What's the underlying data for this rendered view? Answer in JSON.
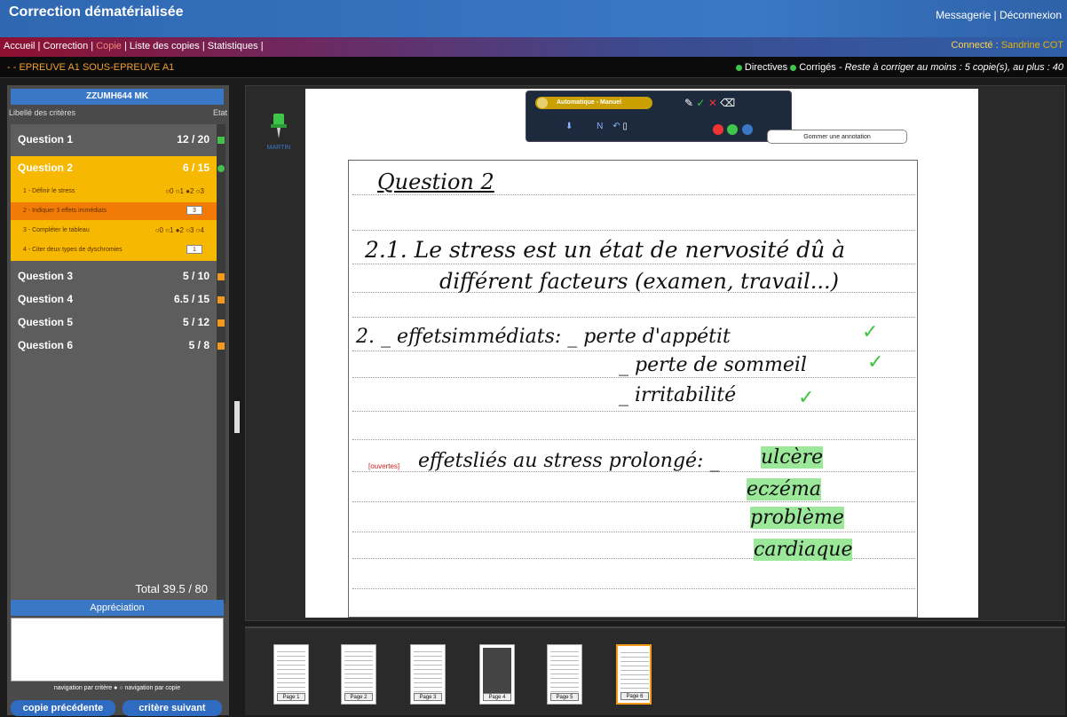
{
  "header": {
    "title": "Correction dématérialisée",
    "links": "Messagerie | Déconnexion"
  },
  "nav": {
    "items": [
      "Accueil",
      "Correction",
      "Copie",
      "Liste des copies",
      "Statistiques"
    ],
    "active": "Copie",
    "connected_label": "Connecté :",
    "connected_user": "Sandrine COT"
  },
  "exam": {
    "title": "- - EPREUVE A1 SOUS-EPREUVE A1",
    "directives": "Directives",
    "corriges": "Corrigés",
    "remaining": "- Reste à corriger au moins :  5 copie(s), au plus : 40"
  },
  "student": {
    "code": "ZZUMH644 MK"
  },
  "criteria_header": {
    "left": "Libellé des critères",
    "right": "Etat"
  },
  "questions": [
    {
      "name": "Question 1",
      "score": "12 / 20",
      "status": "green"
    },
    {
      "name": "Question 2",
      "score": "6 / 15",
      "status": "green"
    },
    {
      "name": "Question 3",
      "score": "5 / 10",
      "status": "orange"
    },
    {
      "name": "Question 4",
      "score": "6.5 / 15",
      "status": "orange"
    },
    {
      "name": "Question 5",
      "score": "5 / 12",
      "status": "orange"
    },
    {
      "name": "Question 6",
      "score": "5 / 8",
      "status": "orange"
    }
  ],
  "subcriteria": [
    {
      "label": "1 - Définir le stress",
      "options": "○0 ○1 ●2 ○3"
    },
    {
      "label": "2 - Indiquer 3 effets immédiats",
      "value": "3"
    },
    {
      "label": "3 - Compléter le tableau",
      "options": "○0 ○1 ●2 ○3 ○4"
    },
    {
      "label": "4 - Citer deux types de dyschromies",
      "value": "1"
    }
  ],
  "total": "Total  39.5 / 80",
  "appreciation": {
    "title": "Appréciation",
    "nav_mode": "navigation par critère ● ○ navigation par copie"
  },
  "buttons": {
    "prev": "copie précédente",
    "next": "critère suivant"
  },
  "toolbar": {
    "mode": "Automatique - Manuel",
    "tooltip": "Gommer une annotation"
  },
  "pin": {
    "caption": "MARTIN"
  },
  "sheet": {
    "heading": "Question 2",
    "line1": "2.1. Le stress est un état de nervosité dû à",
    "line2": "différent facteurs (examen, travail...)",
    "line3a": "2. _ effetsimmédiats: _ perte d'appétit",
    "line3b": "_ perte de sommeil",
    "line3c": "_ irritabilité",
    "line4a": "effetsliés au stress prolongé: _",
    "ann1": "ulcère",
    "ann2": "eczéma",
    "ann3": "problème",
    "ann4": "cardiaque",
    "margin": "[ouvertes]"
  },
  "thumbnails": [
    "Page 1",
    "Page 2",
    "Page 3",
    "Page 4",
    "Page 5",
    "Page 6"
  ],
  "colors": {
    "accent": "#3a78c5",
    "selected": "#f6b800",
    "highlight": "#9be89b"
  }
}
